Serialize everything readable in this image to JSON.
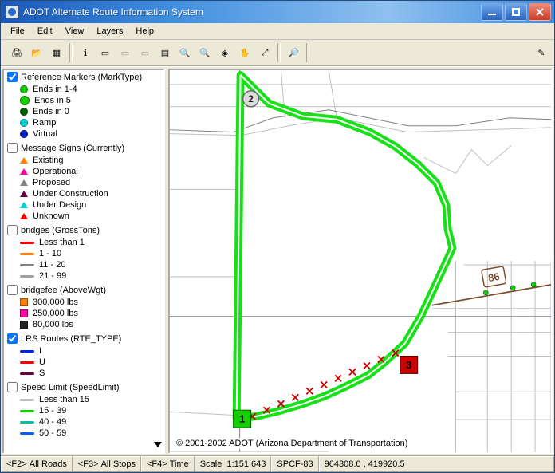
{
  "colors": {
    "accent_green": "#18e018",
    "blocked_red": "#cc0000",
    "road_gray": "#808080",
    "road_light": "#c0c0c0",
    "shield_brown": "#7a4e2e"
  },
  "titlebar": {
    "title": "ADOT Alternate Route Information System"
  },
  "menubar": {
    "items": [
      "File",
      "Edit",
      "View",
      "Layers",
      "Help"
    ]
  },
  "toolbar": {
    "groups": [
      {
        "buttons": [
          {
            "name": "print-button",
            "glyph": "🖨"
          },
          {
            "name": "open-button",
            "glyph": "📂"
          },
          {
            "name": "new-layer-button",
            "glyph": "▦"
          }
        ]
      },
      {
        "buttons": [
          {
            "name": "info-button",
            "glyph": "ℹ"
          },
          {
            "name": "measure-button",
            "glyph": "▭"
          },
          {
            "name": "toggle-a-button",
            "glyph": "▭",
            "disabled": true
          },
          {
            "name": "toggle-b-button",
            "glyph": "▭",
            "disabled": true
          },
          {
            "name": "layers-button",
            "glyph": "▤"
          },
          {
            "name": "zoom-area-button",
            "glyph": "🔍"
          },
          {
            "name": "zoom-in-button",
            "glyph": "🔍"
          },
          {
            "name": "zoom-out-button",
            "glyph": "◈"
          },
          {
            "name": "pan-button",
            "glyph": "✋"
          },
          {
            "name": "zoom-extent-button",
            "glyph": "⤢"
          }
        ]
      },
      {
        "buttons": [
          {
            "name": "find-button",
            "glyph": "🔎"
          }
        ]
      }
    ],
    "right": {
      "name": "edit-toggle-button",
      "glyph": "✎"
    }
  },
  "status": {
    "f2_key": "<F2>",
    "f2_label": "All Roads",
    "f3_key": "<F3>",
    "f3_label": "All Stops",
    "f4_key": "<F4>",
    "f4_label": "Time",
    "scale_label": "Scale",
    "scale_value": "1:151,643",
    "crs": "SPCF-83",
    "coords": "964308.0 , 419920.5"
  },
  "legend": {
    "groups": [
      {
        "id": "refmark",
        "title": "Reference Markers (MarkType)",
        "checked": true,
        "items": [
          {
            "label": "Ends in 1-4",
            "swatch": {
              "type": "circle",
              "fill": "#14d000"
            }
          },
          {
            "label": "Ends in 5",
            "swatch": {
              "type": "circle",
              "fill": "#14d000",
              "big": true
            }
          },
          {
            "label": "Ends in 0",
            "swatch": {
              "type": "circle",
              "fill": "#006000"
            }
          },
          {
            "label": "Ramp",
            "swatch": {
              "type": "circle",
              "fill": "#00d0d0"
            }
          },
          {
            "label": "Virtual",
            "swatch": {
              "type": "circle",
              "fill": "#0020c0"
            }
          }
        ]
      },
      {
        "id": "msgsigns",
        "title": "Message Signs (Currently)",
        "checked": false,
        "items": [
          {
            "label": "Existing",
            "swatch": {
              "type": "tri",
              "fill": "#ff8000"
            }
          },
          {
            "label": "Operational",
            "swatch": {
              "type": "tri",
              "fill": "#ff00a0"
            }
          },
          {
            "label": "Proposed",
            "swatch": {
              "type": "tri",
              "fill": "#808080"
            }
          },
          {
            "label": "Under Construction",
            "swatch": {
              "type": "tri",
              "fill": "#6a0040"
            }
          },
          {
            "label": "Under Design",
            "swatch": {
              "type": "tri",
              "fill": "#00d0d0"
            }
          },
          {
            "label": "Unknown",
            "swatch": {
              "type": "tri",
              "fill": "#ff0000"
            }
          }
        ]
      },
      {
        "id": "bridges",
        "title": "bridges (GrossTons)",
        "checked": false,
        "items": [
          {
            "label": "Less than 1",
            "swatch": {
              "type": "line",
              "color": "#ff0000"
            }
          },
          {
            "label": "1 - 10",
            "swatch": {
              "type": "line",
              "color": "#ff8000"
            }
          },
          {
            "label": "11 - 20",
            "swatch": {
              "type": "line",
              "color": "#808080"
            }
          },
          {
            "label": "21 - 99",
            "swatch": {
              "type": "line",
              "color": "#a0a0a0"
            }
          }
        ]
      },
      {
        "id": "bridgefee",
        "title": "bridgefee (AboveWgt)",
        "checked": false,
        "items": [
          {
            "label": "300,000 lbs",
            "swatch": {
              "type": "sq",
              "fill": "#ff8000"
            }
          },
          {
            "label": "250,000 lbs",
            "swatch": {
              "type": "sq",
              "fill": "#ff00a0"
            }
          },
          {
            "label": "80,000 lbs",
            "swatch": {
              "type": "sq",
              "fill": "#202020"
            }
          }
        ]
      },
      {
        "id": "lrs",
        "title": "LRS Routes (RTE_TYPE)",
        "checked": true,
        "items": [
          {
            "label": "I",
            "swatch": {
              "type": "line",
              "color": "#0020ff"
            }
          },
          {
            "label": "U",
            "swatch": {
              "type": "line",
              "color": "#ff0000"
            }
          },
          {
            "label": "S",
            "swatch": {
              "type": "line",
              "color": "#6a0040"
            }
          }
        ]
      },
      {
        "id": "speed",
        "title": "Speed Limit (SpeedLimit)",
        "checked": false,
        "items": [
          {
            "label": "Less than 15",
            "swatch": {
              "type": "line",
              "color": "#c0c0c0"
            }
          },
          {
            "label": "15 - 39",
            "swatch": {
              "type": "line",
              "color": "#14d000"
            }
          },
          {
            "label": "40 - 49",
            "swatch": {
              "type": "line",
              "color": "#00c0a0"
            }
          },
          {
            "label": "50 - 59",
            "swatch": {
              "type": "line",
              "color": "#0060ff"
            }
          }
        ]
      }
    ]
  },
  "map": {
    "copyright": "© 2001-2002 ADOT (Arizona Department of Transportation)",
    "shield": {
      "label": "86"
    },
    "waypoints": [
      {
        "id": "1",
        "label": "1",
        "kind": "start"
      },
      {
        "id": "2",
        "label": "2",
        "kind": "via"
      },
      {
        "id": "3",
        "label": "3",
        "kind": "blocked"
      }
    ]
  }
}
